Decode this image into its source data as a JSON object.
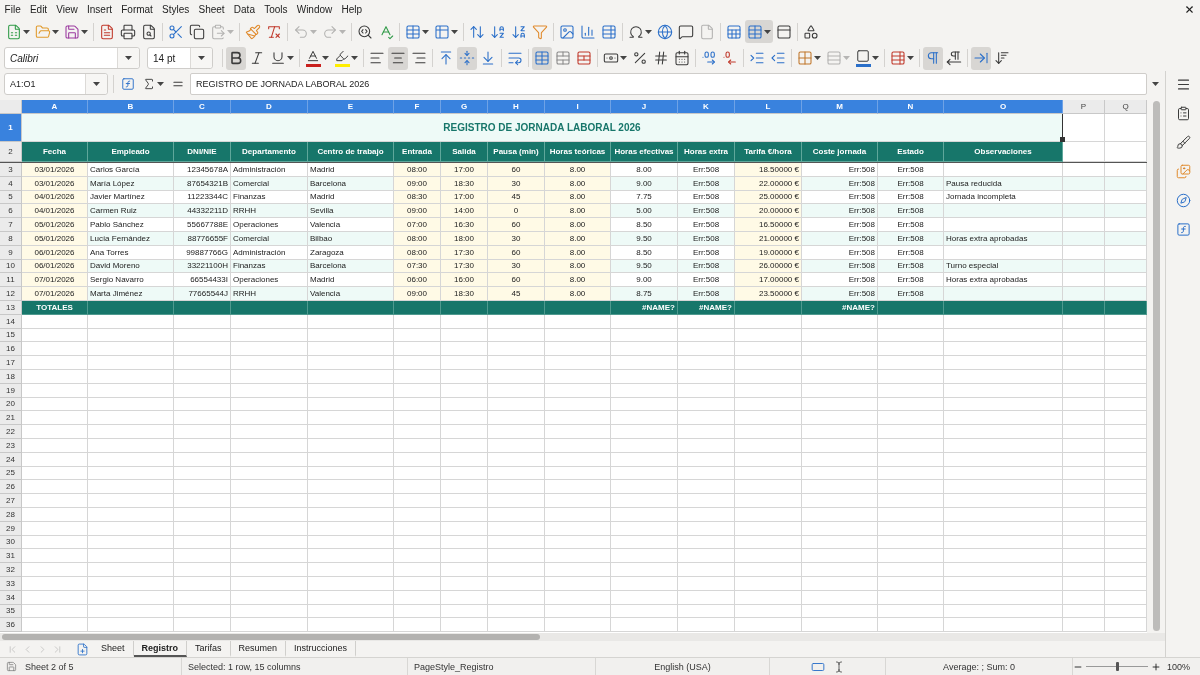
{
  "menu_bar": {
    "items": [
      "File",
      "Edit",
      "View",
      "Insert",
      "Format",
      "Styles",
      "Sheet",
      "Data",
      "Tools",
      "Window",
      "Help"
    ]
  },
  "standard_toolbar": {
    "paste_disabled": true,
    "undo_disabled": true,
    "redo_disabled": true,
    "header_footer_disabled": true,
    "freeze_pressed": true
  },
  "formatting_toolbar": {
    "font_name": "Calibri",
    "font_size": "14 pt",
    "bold": true,
    "italic": false,
    "underline": false,
    "align_left": false,
    "align_center": true,
    "align_right": false,
    "align_top": false,
    "align_middle": true,
    "align_bottom": false,
    "wrap_text": false,
    "merge_center": true,
    "border_style_disabled": true,
    "left_to_right": true,
    "right_to_left": false,
    "text_horizontal": true,
    "text_vertical": false
  },
  "formula_bar": {
    "name_box": "A1:O1",
    "formula": "REGISTRO DE JORNADA LABORAL 2026"
  },
  "sheet": {
    "column_headers": [
      {
        "label": "A",
        "selected": true
      },
      {
        "label": "B",
        "selected": true
      },
      {
        "label": "C",
        "selected": true
      },
      {
        "label": "D",
        "selected": true
      },
      {
        "label": "E",
        "selected": true
      },
      {
        "label": "F",
        "selected": true
      },
      {
        "label": "G",
        "selected": true
      },
      {
        "label": "H",
        "selected": true
      },
      {
        "label": "I",
        "selected": true
      },
      {
        "label": "J",
        "selected": true
      },
      {
        "label": "K",
        "selected": true
      },
      {
        "label": "L",
        "selected": true
      },
      {
        "label": "M",
        "selected": true
      },
      {
        "label": "N",
        "selected": true
      },
      {
        "label": "O",
        "selected": true
      },
      {
        "label": "P",
        "selected": false
      },
      {
        "label": "Q",
        "selected": false
      }
    ],
    "row_headers": [
      {
        "label": "1",
        "selected": true
      },
      {
        "label": "2",
        "selected": false
      },
      {
        "label": "3",
        "selected": false
      },
      {
        "label": "4",
        "selected": false
      },
      {
        "label": "5",
        "selected": false
      },
      {
        "label": "6",
        "selected": false
      },
      {
        "label": "7",
        "selected": false
      },
      {
        "label": "8",
        "selected": false
      },
      {
        "label": "9",
        "selected": false
      },
      {
        "label": "10",
        "selected": false
      },
      {
        "label": "11",
        "selected": false
      },
      {
        "label": "12",
        "selected": false
      },
      {
        "label": "13",
        "selected": false
      },
      {
        "label": "14",
        "selected": false
      },
      {
        "label": "15",
        "selected": false
      },
      {
        "label": "16",
        "selected": false
      },
      {
        "label": "17",
        "selected": false
      },
      {
        "label": "18",
        "selected": false
      },
      {
        "label": "19",
        "selected": false
      },
      {
        "label": "20",
        "selected": false
      },
      {
        "label": "21",
        "selected": false
      },
      {
        "label": "22",
        "selected": false
      },
      {
        "label": "23",
        "selected": false
      },
      {
        "label": "24",
        "selected": false
      },
      {
        "label": "25",
        "selected": false
      },
      {
        "label": "26",
        "selected": false
      },
      {
        "label": "27",
        "selected": false
      },
      {
        "label": "28",
        "selected": false
      },
      {
        "label": "29",
        "selected": false
      },
      {
        "label": "30",
        "selected": false
      },
      {
        "label": "31",
        "selected": false
      },
      {
        "label": "32",
        "selected": false
      },
      {
        "label": "33",
        "selected": false
      },
      {
        "label": "34",
        "selected": false
      },
      {
        "label": "35",
        "selected": false
      },
      {
        "label": "36",
        "selected": false
      }
    ],
    "title": "REGISTRO DE JORNADA LABORAL 2026",
    "header": [
      {
        "text": "Fecha",
        "shaded": true
      },
      {
        "text": "Empleado",
        "shaded": false
      },
      {
        "text": "DNI/NIE",
        "shaded": false
      },
      {
        "text": "Departamento",
        "shaded": false
      },
      {
        "text": "Centro de trabajo",
        "shaded": false
      },
      {
        "text": "Entrada",
        "shaded": true
      },
      {
        "text": "Salida",
        "shaded": true
      },
      {
        "text": "Pausa (min)",
        "shaded": true
      },
      {
        "text": "Horas teóricas",
        "shaded": true
      },
      {
        "text": "Horas efectivas",
        "shaded": false
      },
      {
        "text": "Horas extra",
        "shaded": false
      },
      {
        "text": "Tarifa €/hora",
        "shaded": true
      },
      {
        "text": "Coste jornada",
        "shaded": false
      },
      {
        "text": "Estado",
        "shaded": false
      },
      {
        "text": "Observaciones",
        "shaded": false
      }
    ],
    "rows": [
      {
        "fecha": "03/01/2026",
        "empleado": "Carlos García",
        "dni_nie": "12345678A",
        "departamento": "Administración",
        "centro_de_trabajo": "Madrid",
        "entrada": "08:00",
        "salida": "17:00",
        "pausa_min": "60",
        "horas_teoricas": "8.00",
        "horas_efectivas": "8.00",
        "horas_extra": "Err:508",
        "tarifa_hora": "18.50000 €",
        "coste_jornada": "Err:508",
        "estado": "Err:508"
      },
      {
        "fecha": "03/01/2026",
        "empleado": "María López",
        "dni_nie": "87654321B",
        "departamento": "Comercial",
        "centro_de_trabajo": "Barcelona",
        "entrada": "09:00",
        "salida": "18:30",
        "pausa_min": "30",
        "horas_teoricas": "8.00",
        "horas_efectivas": "9.00",
        "horas_extra": "Err:508",
        "tarifa_hora": "22.00000 €",
        "coste_jornada": "Err:508",
        "estado": "Err:508",
        "observaciones": "Pausa reducida"
      },
      {
        "fecha": "04/01/2026",
        "empleado": "Javier Martínez",
        "dni_nie": "11223344C",
        "departamento": "Finanzas",
        "centro_de_trabajo": "Madrid",
        "entrada": "08:30",
        "salida": "17:00",
        "pausa_min": "45",
        "horas_teoricas": "8.00",
        "horas_efectivas": "7.75",
        "horas_extra": "Err:508",
        "tarifa_hora": "25.00000 €",
        "coste_jornada": "Err:508",
        "estado": "Err:508",
        "observaciones": "Jornada incompleta"
      },
      {
        "fecha": "04/01/2026",
        "empleado": "Carmen Ruiz",
        "dni_nie": "44332211D",
        "departamento": "RRHH",
        "centro_de_trabajo": "Sevilla",
        "entrada": "09:00",
        "salida": "14:00",
        "pausa_min": "0",
        "horas_teoricas": "8.00",
        "horas_efectivas": "5.00",
        "horas_extra": "Err:508",
        "tarifa_hora": "20.00000 €",
        "coste_jornada": "Err:508",
        "estado": "Err:508"
      },
      {
        "fecha": "05/01/2026",
        "empleado": "Pablo Sánchez",
        "dni_nie": "55667788E",
        "departamento": "Operaciones",
        "centro_de_trabajo": "Valencia",
        "entrada": "07:00",
        "salida": "16:30",
        "pausa_min": "60",
        "horas_teoricas": "8.00",
        "horas_efectivas": "8.50",
        "horas_extra": "Err:508",
        "tarifa_hora": "16.50000 €",
        "coste_jornada": "Err:508",
        "estado": "Err:508"
      },
      {
        "fecha": "05/01/2026",
        "empleado": "Lucía Fernández",
        "dni_nie": "88776655F",
        "departamento": "Comercial",
        "centro_de_trabajo": "Bilbao",
        "entrada": "08:00",
        "salida": "18:00",
        "pausa_min": "30",
        "horas_teoricas": "8.00",
        "horas_efectivas": "9.50",
        "horas_extra": "Err:508",
        "tarifa_hora": "21.00000 €",
        "coste_jornada": "Err:508",
        "estado": "Err:508",
        "observaciones": "Horas extra aprobadas"
      },
      {
        "fecha": "06/01/2026",
        "empleado": "Ana Torres",
        "dni_nie": "99887766G",
        "departamento": "Administración",
        "centro_de_trabajo": "Zaragoza",
        "entrada": "08:00",
        "salida": "17:30",
        "pausa_min": "60",
        "horas_teoricas": "8.00",
        "horas_efectivas": "8.50",
        "horas_extra": "Err:508",
        "tarifa_hora": "19.00000 €",
        "coste_jornada": "Err:508",
        "estado": "Err:508"
      },
      {
        "fecha": "06/01/2026",
        "empleado": "David Moreno",
        "dni_nie": "33221100H",
        "departamento": "Finanzas",
        "centro_de_trabajo": "Barcelona",
        "entrada": "07:30",
        "salida": "17:30",
        "pausa_min": "30",
        "horas_teoricas": "8.00",
        "horas_efectivas": "9.50",
        "horas_extra": "Err:508",
        "tarifa_hora": "26.00000 €",
        "coste_jornada": "Err:508",
        "estado": "Err:508",
        "observaciones": "Turno especial"
      },
      {
        "fecha": "07/01/2026",
        "empleado": "Sergio Navarro",
        "dni_nie": "66554433I",
        "departamento": "Operaciones",
        "centro_de_trabajo": "Madrid",
        "entrada": "06:00",
        "salida": "16:00",
        "pausa_min": "60",
        "horas_teoricas": "8.00",
        "horas_efectivas": "9.00",
        "horas_extra": "Err:508",
        "tarifa_hora": "17.00000 €",
        "coste_jornada": "Err:508",
        "estado": "Err:508",
        "observaciones": "Horas extra aprobadas"
      },
      {
        "fecha": "07/01/2026",
        "empleado": "Marta Jiménez",
        "dni_nie": "77665544J",
        "departamento": "RRHH",
        "centro_de_trabajo": "Valencia",
        "entrada": "09:00",
        "salida": "18:30",
        "pausa_min": "45",
        "horas_teoricas": "8.00",
        "horas_efectivas": "8.75",
        "horas_extra": "Err:508",
        "tarifa_hora": "23.50000 €",
        "coste_jornada": "Err:508",
        "estado": "Err:508"
      }
    ],
    "totals": {
      "fecha": "TOTALES",
      "horas_efectivas": "#NAME?",
      "horas_extra": "#NAME?",
      "coste_jornada": "#NAME?"
    }
  },
  "sheet_tab_bar": {
    "navigation_disabled": true,
    "tabs": [
      {
        "label": "Sheet",
        "selected": false
      },
      {
        "label": "Registro",
        "selected": true
      },
      {
        "label": "Tarifas",
        "selected": false
      },
      {
        "label": "Resumen",
        "selected": false
      },
      {
        "label": "Instrucciones",
        "selected": false
      }
    ]
  },
  "status_bar": {
    "sheet_position": "Sheet 2 of 5",
    "selection": "Selected: 1 row, 15 columns",
    "page_style": "PageStyle_Registro",
    "language": "English (USA)",
    "summary": "Average: ; Sum: 0",
    "zoom_slider": {
      "level": 0.5
    },
    "zoom": "100%"
  }
}
